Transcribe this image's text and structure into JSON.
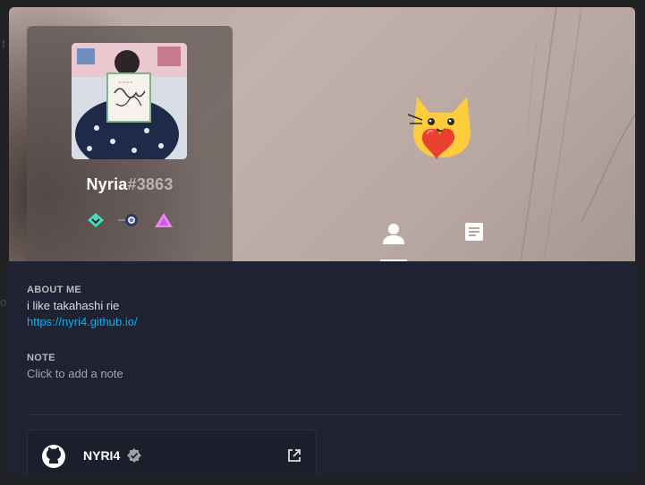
{
  "profile": {
    "username": "Nyria",
    "discriminator": "#3863",
    "badges": [
      "hypesquad-balance-icon",
      "nitro-boost-icon",
      "early-supporter-icon"
    ]
  },
  "tabs": [
    {
      "name": "user-info",
      "icon": "person-icon",
      "active": true
    },
    {
      "name": "activity",
      "icon": "note-icon",
      "active": false
    }
  ],
  "about_me": {
    "title": "ABOUT ME",
    "text": "i like takahashi rie",
    "link": "https://nyri4.github.io/"
  },
  "note": {
    "title": "NOTE",
    "placeholder": "Click to add a note"
  },
  "connections": [
    {
      "service": "github",
      "icon": "github-icon",
      "name": "NYRI4",
      "verified": true
    }
  ],
  "colors": {
    "panel": "#1e2232",
    "link": "#00aff4",
    "banner": "#b8a7a0"
  }
}
